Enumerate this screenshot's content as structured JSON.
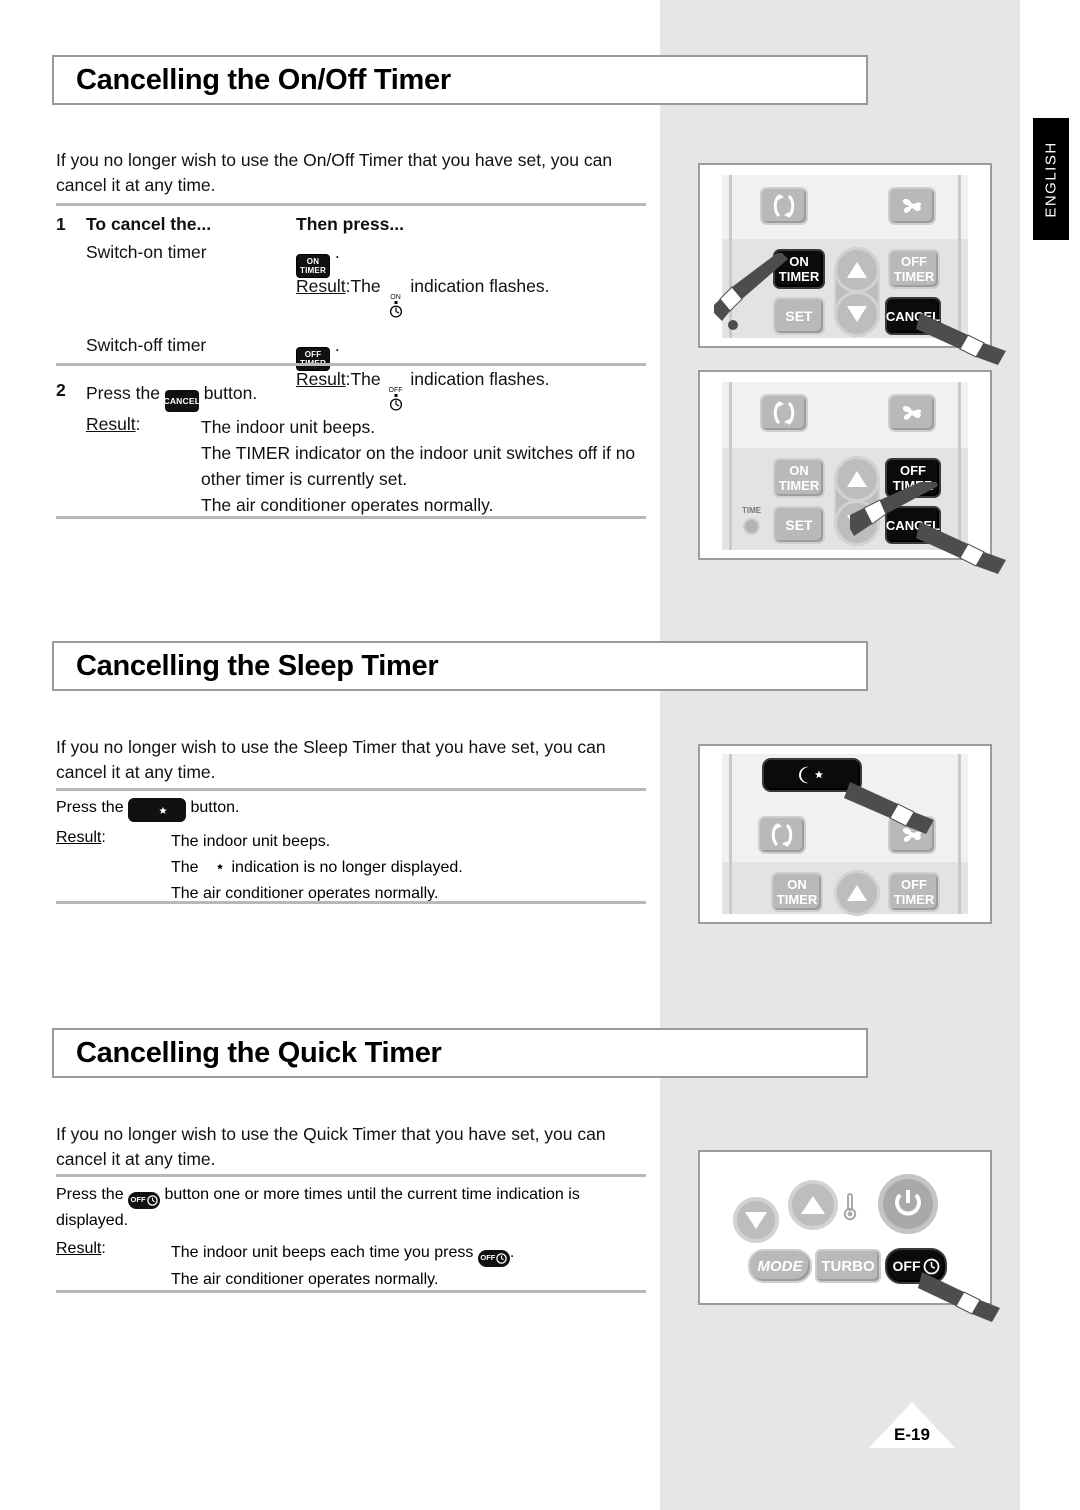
{
  "lang_tab": "ENGLISH",
  "page_number": "E-19",
  "sections": [
    {
      "title": "Cancelling the On/Off Timer",
      "intro": "If you no longer wish to use the On/Off Timer that you have set, you can cancel it at any time.",
      "step1": {
        "number": "1",
        "col1_header": "To cancel the...",
        "col2_header": "Then press...",
        "rows": [
          {
            "label": "Switch-on timer",
            "button": {
              "line1": "ON",
              "line2": "TIMER",
              "name": "on-timer-button"
            },
            "period": ".",
            "result_label": "Result",
            "result_sep": ":",
            "result_pre": "The",
            "indicator_tag": "ON",
            "result_post": "indication flashes."
          },
          {
            "label": "Switch-off timer",
            "button": {
              "line1": "OFF",
              "line2": "TIMER",
              "name": "off-timer-button"
            },
            "period": ".",
            "result_label": "Result",
            "result_sep": ":",
            "result_pre": "The",
            "indicator_tag": "OFF",
            "result_post": "indication flashes."
          }
        ]
      },
      "step2": {
        "number": "2",
        "pre": "Press the",
        "button_label": "CANCEL",
        "post": "button.",
        "result_label": "Result",
        "result_sep": ":",
        "results": [
          "The indoor unit beeps.",
          "The TIMER indicator on the indoor unit switches off if no",
          "other timer is currently set.",
          "The air conditioner operates normally."
        ]
      }
    },
    {
      "title": "Cancelling the Sleep Timer",
      "intro": "If you no longer wish to use the Sleep Timer that you have set, you can cancel it at any time.",
      "press": {
        "pre": "Press the",
        "button_icon": "moon-star-icon",
        "post": "button.",
        "result_label": "Result",
        "result_sep": ":",
        "results": [
          {
            "text": "The indoor unit beeps."
          },
          {
            "pre": "The",
            "icon": "moon-star-icon",
            "post": "indication is no longer displayed."
          },
          {
            "text": "The air conditioner operates normally."
          }
        ]
      }
    },
    {
      "title": "Cancelling the Quick Timer",
      "intro": "If you no longer wish to use the Quick Timer that you have set, you can cancel it at any time.",
      "press": {
        "pre": "Press the",
        "button_label": "OFF",
        "post_line1": "button one or more times until the current time indication is",
        "post_line2": "displayed.",
        "result_label": "Result",
        "result_sep": ":",
        "result1_pre": "The indoor unit beeps each time you press",
        "result1_post": ".",
        "result2": "The air conditioner operates normally."
      }
    }
  ],
  "illustrations": [
    {
      "name": "remote-on-timer-cancel",
      "keys": [
        {
          "label": "",
          "icon": "swing-icon",
          "state": "normal"
        },
        {
          "label": "",
          "icon": "fan-icon",
          "state": "normal"
        },
        {
          "line1": "ON",
          "line2": "TIMER",
          "state": "highlighted"
        },
        {
          "line1": "OFF",
          "line2": "TIMER",
          "state": "normal"
        },
        {
          "label": "SET",
          "state": "normal"
        },
        {
          "label": "CANCEL",
          "state": "highlighted"
        }
      ],
      "pointers": [
        "on-timer",
        "cancel"
      ]
    },
    {
      "name": "remote-off-timer-cancel",
      "time_label": "TIME",
      "keys": [
        {
          "label": "",
          "icon": "swing-icon",
          "state": "normal"
        },
        {
          "label": "",
          "icon": "fan-icon",
          "state": "normal"
        },
        {
          "line1": "ON",
          "line2": "TIMER",
          "state": "normal"
        },
        {
          "line1": "OFF",
          "line2": "TIMER",
          "state": "highlighted"
        },
        {
          "label": "SET",
          "state": "normal"
        },
        {
          "label": "CANCEL",
          "state": "highlighted"
        }
      ],
      "pointers": [
        "off-timer",
        "cancel"
      ]
    },
    {
      "name": "remote-sleep-button",
      "keys": [
        {
          "label": "",
          "icon": "moon-star-icon",
          "state": "highlighted"
        },
        {
          "label": "",
          "icon": "swing-icon",
          "state": "normal"
        },
        {
          "label": "",
          "icon": "fan-icon",
          "state": "normal"
        },
        {
          "line1": "ON",
          "line2": "TIMER",
          "state": "normal"
        },
        {
          "line1": "OFF",
          "line2": "TIMER",
          "state": "normal"
        }
      ],
      "pointers": [
        "sleep"
      ]
    },
    {
      "name": "remote-quick-timer",
      "keys": [
        {
          "label": "MODE",
          "state": "normal"
        },
        {
          "label": "TURBO",
          "state": "normal"
        },
        {
          "label": "OFF",
          "icon": "clock-icon",
          "state": "highlighted"
        }
      ],
      "icons": [
        "down-arrow-icon",
        "up-arrow-icon",
        "thermometer-icon",
        "power-icon"
      ],
      "pointers": [
        "off-quick"
      ]
    }
  ]
}
